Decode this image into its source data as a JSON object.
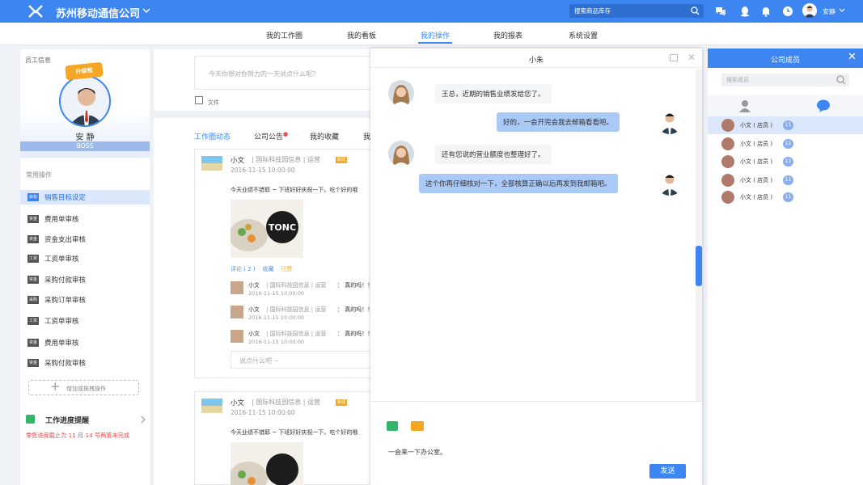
{
  "header": {
    "company": "苏州移动通信公司",
    "search_placeholder": "搜索商品库存",
    "user_name": "安静"
  },
  "nav": {
    "items": [
      "我的工作圈",
      "我的看板",
      "我的操作",
      "我的报表",
      "系统设置"
    ],
    "active": "我的操作"
  },
  "employee": {
    "section_title": "员工信息",
    "badge": "升级啦",
    "name": "安 静",
    "role": "BOSS"
  },
  "operations": {
    "title": "常用操作",
    "items": [
      {
        "tag": "目标",
        "label": "销售目标设定",
        "active": true
      },
      {
        "tag": "资金",
        "label": "费用单审核"
      },
      {
        "tag": "资金",
        "label": "资金支出审核"
      },
      {
        "tag": "工资",
        "label": "工资单审核"
      },
      {
        "tag": "资金",
        "label": "采购付款审核"
      },
      {
        "tag": "采购",
        "label": "采购订单审核"
      },
      {
        "tag": "工资",
        "label": "工资单审核"
      },
      {
        "tag": "资金",
        "label": "费用单审核"
      },
      {
        "tag": "资金",
        "label": "采购付款审核"
      }
    ],
    "add_label": "增加或拖拽操作"
  },
  "progress": {
    "title": "工作进度提醒",
    "note": "零售进度截止为 11 月 14 号两笔未完成"
  },
  "composer": {
    "placeholder": "今天你想对你努力的一天说点什么呢？",
    "file_label": "文件"
  },
  "feed": {
    "tabs": [
      "工作圈动态",
      "公司公告",
      "我的收藏",
      "我"
    ],
    "post": {
      "author": "小文",
      "meta": "| 国际科技园信息 | 运营",
      "tag": "新闻",
      "date": "2016-11-15  10:00:00",
      "text": "今天业绩不错耶 ~ 下班好好庆祝一下。吃个好的哦",
      "image_text": "TONC",
      "actions": {
        "comment": "评论 ( 2 )",
        "favorite": "收藏",
        "like": "已赞"
      }
    },
    "replies": [
      {
        "name": "小文",
        "org": "| 国际科技园信息 | 运营",
        "text": "：  真的吗！！等",
        "date": "2016-11-15  10:00:00"
      },
      {
        "name": "小文",
        "org": "| 国际科技园信息 | 运营",
        "text": "：  真的吗！！等",
        "date": "2016-11-15  10:00:00"
      },
      {
        "name": "小文",
        "org": "| 国际科技园信息 | 运营",
        "text": "：  真的吗！！等",
        "date": "2016-11-15  10:00:00"
      }
    ],
    "comment_placeholder": "说点什么吧 ~"
  },
  "chat": {
    "title": "小朱",
    "messages": [
      {
        "side": "left",
        "text": "王总，近期的销售业绩发给您了。"
      },
      {
        "side": "right",
        "text": "好的，一会开完会我去邮箱看看吧。"
      },
      {
        "side": "left",
        "text": "还有您说的营业额度也整理好了。"
      },
      {
        "side": "right",
        "text": "这个你再仔细核对一下，全部核算正确以后再发到我邮箱吧。"
      }
    ],
    "draft": "一会来一下办公室。",
    "send_label": "发送"
  },
  "members": {
    "title": "公司成员",
    "search_placeholder": "搜索成员",
    "list": [
      {
        "name": "小文 ( 店员 )",
        "count": "11",
        "active": true
      },
      {
        "name": "小文 ( 店员 )",
        "count": "11"
      },
      {
        "name": "小文 ( 店员 )",
        "count": "11"
      },
      {
        "name": "小文 ( 店员 )",
        "count": "11"
      },
      {
        "name": "小文 ( 店员 )",
        "count": "11"
      }
    ]
  },
  "colors": {
    "primary": "#3d86f2",
    "accent_orange": "#f5a623",
    "alert_red": "#e54b4b",
    "green": "#34b36b"
  }
}
